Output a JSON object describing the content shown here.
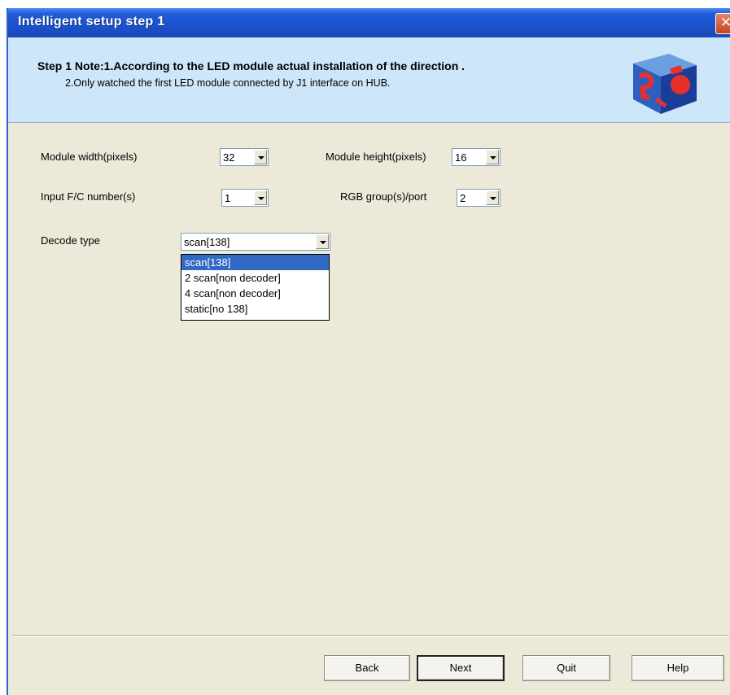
{
  "window": {
    "title": "Intelligent setup step 1",
    "close_glyph": "✕"
  },
  "header": {
    "note_line1": "Step 1 Note:1.According to the LED module actual installation of the direction .",
    "note_line2": "2.Only watched the first LED module connected by J1 interface on HUB.",
    "logo_icon": "colored-cube-icon"
  },
  "form": {
    "module_width": {
      "label": "Module width(pixels)",
      "value": "32"
    },
    "module_height": {
      "label": "Module height(pixels)",
      "value": "16"
    },
    "input_fc": {
      "label": "Input F/C number(s)",
      "value": "1"
    },
    "rgb_group": {
      "label": "RGB group(s)/port",
      "value": "2"
    },
    "decode_type": {
      "label": "Decode type",
      "value": "scan[138]",
      "options": [
        "scan[138]",
        "2 scan[non decoder]",
        "4 scan[non decoder]",
        "static[no 138]"
      ],
      "selected_index": 0
    }
  },
  "buttons": {
    "back": "Back",
    "next": "Next",
    "quit": "Quit",
    "help": "Help"
  },
  "colors": {
    "titlebar": "#1e5ad6",
    "header_bg": "#cde6fa",
    "dialog_bg": "#ece9d8",
    "selection": "#316ac5"
  }
}
